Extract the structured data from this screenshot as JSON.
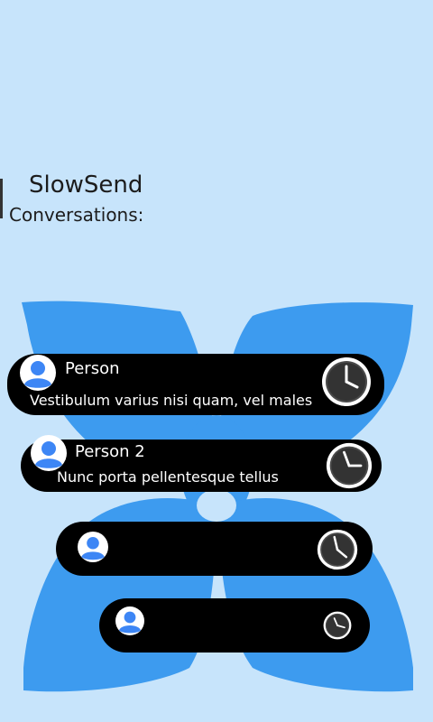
{
  "app": {
    "title": "SlowSend",
    "subtitle": "Conversations:"
  },
  "conversations": [
    {
      "name": "Person",
      "message": "Vestibulum varius nisi quam, vel males",
      "avatar_icon": "person-icon",
      "status_icon": "clock-icon"
    },
    {
      "name": "Person 2",
      "message": "Nunc porta pellentesque tellus",
      "avatar_icon": "person-icon",
      "status_icon": "clock-icon"
    },
    {
      "name": "",
      "message": "",
      "avatar_icon": "person-icon",
      "status_icon": "clock-icon"
    },
    {
      "name": "",
      "message": "",
      "avatar_icon": "person-icon",
      "status_icon": "clock-icon"
    }
  ],
  "colors": {
    "background": "#c7e4fb",
    "petal": "#3d9bef",
    "card": "#000000",
    "avatar_blue": "#3d86f5"
  }
}
